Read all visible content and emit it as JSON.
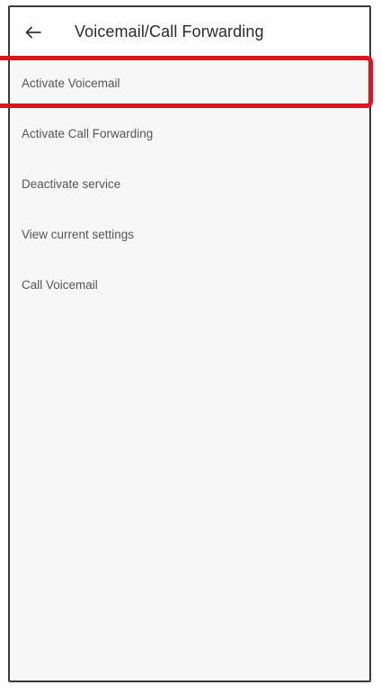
{
  "header": {
    "back_icon": "arrow-left-icon",
    "title": "Voicemail/Call Forwarding"
  },
  "menu": {
    "items": [
      {
        "label": "Activate Voicemail",
        "highlighted": true
      },
      {
        "label": "Activate Call Forwarding",
        "highlighted": false
      },
      {
        "label": "Deactivate service",
        "highlighted": false
      },
      {
        "label": "View current settings",
        "highlighted": false
      },
      {
        "label": "Call Voicemail",
        "highlighted": false
      }
    ]
  },
  "colors": {
    "highlight": "#e0141e",
    "text": "#555555",
    "title": "#2b2b2b"
  }
}
